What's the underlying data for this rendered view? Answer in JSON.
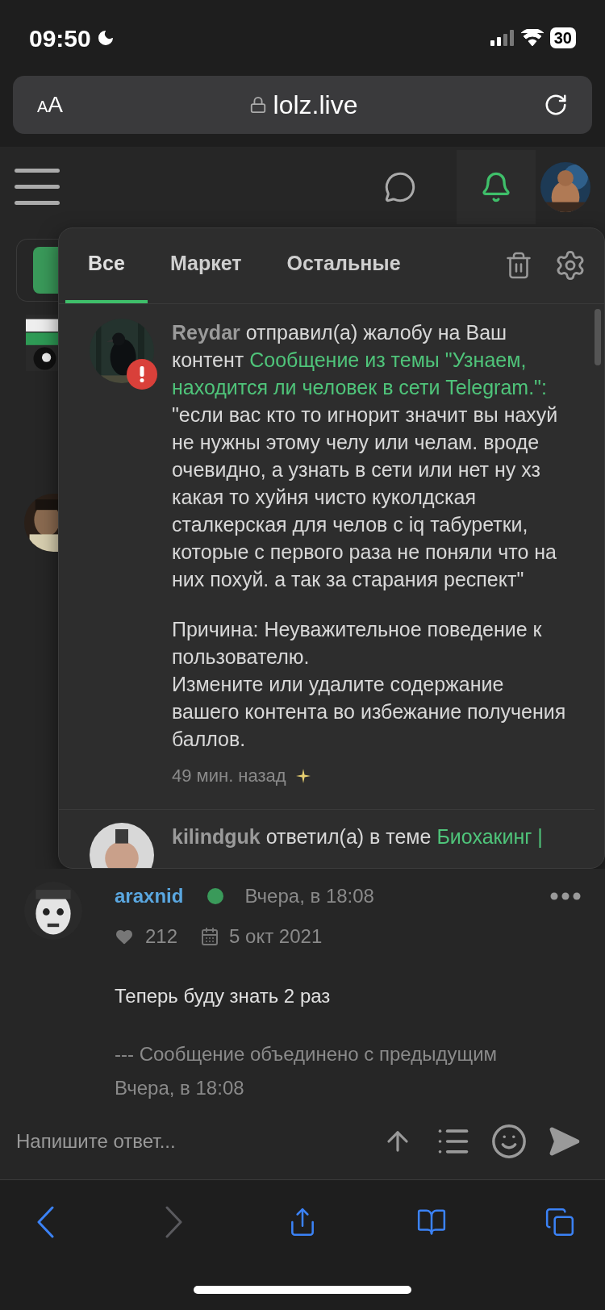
{
  "status_bar": {
    "time": "09:50",
    "battery": "30"
  },
  "address_bar": {
    "text_size_small": "A",
    "text_size_large": "A",
    "url": "lolz.live"
  },
  "header": {
    "notifications_active": true
  },
  "notifications": {
    "tabs": [
      {
        "label": "Все",
        "selected": true
      },
      {
        "label": "Маркет",
        "selected": false
      },
      {
        "label": "Остальные",
        "selected": false
      }
    ],
    "items": [
      {
        "user": "Reydar",
        "action": "отправил(а) жалобу на Ваш контент",
        "link": "Сообщение из темы \"Узнаем, находится ли человек в сети Telegram.\":",
        "quote": "\"если вас кто то игнорит значит вы нахуй не нужны этому челу или челам. вроде очевидно, а узнать в сети или нет ну хз какая то хуйня чисто куколдская сталкерская для челов с iq табуретки, которые с первого раза не поняли что на них похуй. а так за старания респект\"",
        "reason": "Причина: Неуважительное поведение к пользователю.",
        "advice": "Измените или удалите содержание вашего контента во избежание получения баллов.",
        "time": "49 мин. назад",
        "alert": true
      },
      {
        "user": "kilindguk",
        "action": "ответил(а) в теме",
        "link": "Биохакинг |"
      }
    ]
  },
  "post": {
    "author": "araxnid",
    "online": true,
    "date": "Вчера, в 18:08",
    "likes": "212",
    "joined": "5 окт 2021",
    "body": "Теперь буду знать 2 раз",
    "merged_note": "--- Сообщение объединено с предыдущим",
    "merged_time": "Вчера, в 18:08"
  },
  "reply": {
    "placeholder": "Напишите ответ..."
  },
  "toolbar": [
    {
      "kind": "back",
      "disabled": false
    },
    {
      "kind": "forward",
      "disabled": true
    },
    {
      "kind": "share",
      "disabled": false
    },
    {
      "kind": "bookmarks",
      "disabled": false
    },
    {
      "kind": "tabs",
      "disabled": false
    }
  ]
}
